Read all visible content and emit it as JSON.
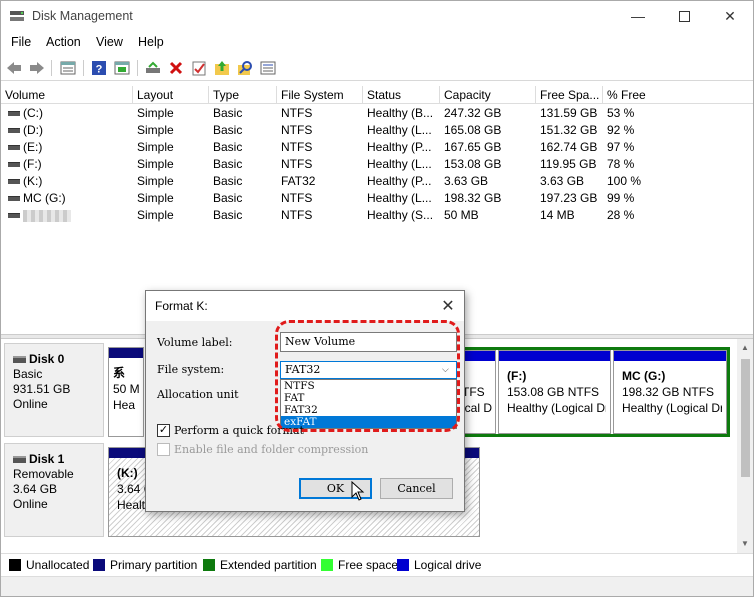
{
  "window": {
    "title": "Disk Management"
  },
  "menu": [
    "File",
    "Action",
    "View",
    "Help"
  ],
  "columns": [
    "Volume",
    "Layout",
    "Type",
    "File System",
    "Status",
    "Capacity",
    "Free Spa...",
    "% Free"
  ],
  "volumes": [
    {
      "volume": "(C:)",
      "layout": "Simple",
      "type": "Basic",
      "fs": "NTFS",
      "status": "Healthy (B...",
      "capacity": "247.32 GB",
      "free": "131.59 GB",
      "pct": "53 %"
    },
    {
      "volume": "(D:)",
      "layout": "Simple",
      "type": "Basic",
      "fs": "NTFS",
      "status": "Healthy (L...",
      "capacity": "165.08 GB",
      "free": "151.32 GB",
      "pct": "92 %"
    },
    {
      "volume": "(E:)",
      "layout": "Simple",
      "type": "Basic",
      "fs": "NTFS",
      "status": "Healthy (P...",
      "capacity": "167.65 GB",
      "free": "162.74 GB",
      "pct": "97 %"
    },
    {
      "volume": "(F:)",
      "layout": "Simple",
      "type": "Basic",
      "fs": "NTFS",
      "status": "Healthy (L...",
      "capacity": "153.08 GB",
      "free": "119.95 GB",
      "pct": "78 %"
    },
    {
      "volume": "(K:)",
      "layout": "Simple",
      "type": "Basic",
      "fs": "FAT32",
      "status": "Healthy (P...",
      "capacity": "3.63 GB",
      "free": "3.63 GB",
      "pct": "100 %"
    },
    {
      "volume": "MC (G:)",
      "layout": "Simple",
      "type": "Basic",
      "fs": "NTFS",
      "status": "Healthy (L...",
      "capacity": "198.32 GB",
      "free": "197.23 GB",
      "pct": "99 %"
    },
    {
      "volume": "",
      "layout": "Simple",
      "type": "Basic",
      "fs": "NTFS",
      "status": "Healthy (S...",
      "capacity": "50 MB",
      "free": "14 MB",
      "pct": "28 %"
    }
  ],
  "disks": [
    {
      "name": "Disk 0",
      "type": "Basic",
      "size": "931.51 GB",
      "state": "Online"
    },
    {
      "name": "Disk 1",
      "type": "Removable",
      "size": "3.64 GB",
      "state": "Online"
    }
  ],
  "partitions": {
    "disk0_p1": {
      "line1": "系",
      "line2": "50 M",
      "line3": "Hea"
    },
    "disk0_f": {
      "title": "(F:)",
      "line2": "153.08 GB NTFS",
      "line3": "Healthy (Logical Dr"
    },
    "disk0_g": {
      "title": "MC  (G:)",
      "line2": "198.32 GB NTFS",
      "line3": "Healthy (Logical Dr"
    },
    "disk0_e_frag": {
      "line2": "TFS",
      "line3": "ical D"
    },
    "disk1_k": {
      "title": "(K:)",
      "line2": "3.64 G",
      "line3": "Health"
    }
  },
  "legend": [
    {
      "label": "Unallocated",
      "color": "#000000"
    },
    {
      "label": "Primary partition",
      "color": "#0a0a7a"
    },
    {
      "label": "Extended partition",
      "color": "#0e7a0e"
    },
    {
      "label": "Free space",
      "color": "#33ff33"
    },
    {
      "label": "Logical drive",
      "color": "#0000d0"
    }
  ],
  "dialog": {
    "title": "Format K:",
    "volume_label_label": "Volume label:",
    "volume_label_value": "New Volume",
    "file_system_label": "File system:",
    "file_system_value": "FAT32",
    "allocation_label": "Allocation unit",
    "fs_options": [
      "NTFS",
      "FAT",
      "FAT32",
      "exFAT"
    ],
    "selected_option": "exFAT",
    "quick_format_label": "Perform a quick format",
    "compression_label": "Enable file and folder compression",
    "ok_label": "OK",
    "cancel_label": "Cancel"
  }
}
